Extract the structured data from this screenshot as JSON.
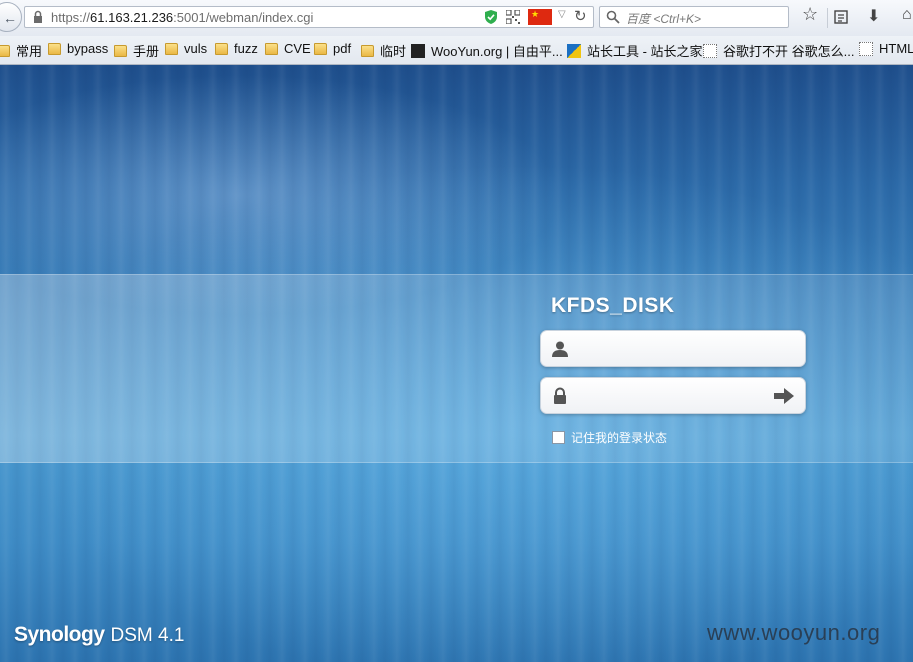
{
  "browser": {
    "url_prefix": "https://",
    "url_host": "61.163.21.236",
    "url_path": ":5001/webman/index.cgi",
    "search_placeholder": "百度 <Ctrl+K>"
  },
  "bookmarks": [
    {
      "label": "常用",
      "icon": "folder-icon"
    },
    {
      "label": "bypass",
      "icon": "folder-icon"
    },
    {
      "label": "手册",
      "icon": "folder-icon"
    },
    {
      "label": "vuls",
      "icon": "folder-icon"
    },
    {
      "label": "fuzz",
      "icon": "folder-icon"
    },
    {
      "label": "CVE",
      "icon": "folder-icon"
    },
    {
      "label": "pdf",
      "icon": "folder-icon"
    },
    {
      "label": "临时",
      "icon": "folder-icon"
    },
    {
      "label": "WooYun.org | 自由平...",
      "icon": "wooyun-icon"
    },
    {
      "label": "站长工具 - 站长之家",
      "icon": "chinaz-icon"
    },
    {
      "label": "谷歌打不开 谷歌怎么...",
      "icon": "page-icon"
    },
    {
      "label": "HTML",
      "icon": "page-icon"
    }
  ],
  "login": {
    "hostname": "KFDS_DISK",
    "username_value": "",
    "password_value": "",
    "remember_label": "记住我的登录状态"
  },
  "footer": {
    "brand": "Synology",
    "version": "DSM 4.1",
    "watermark": "www.wooyun.org"
  },
  "colors": {
    "background_top": "#1f4f8c",
    "background_mid": "#4a99cf",
    "flag": "#de2910"
  }
}
